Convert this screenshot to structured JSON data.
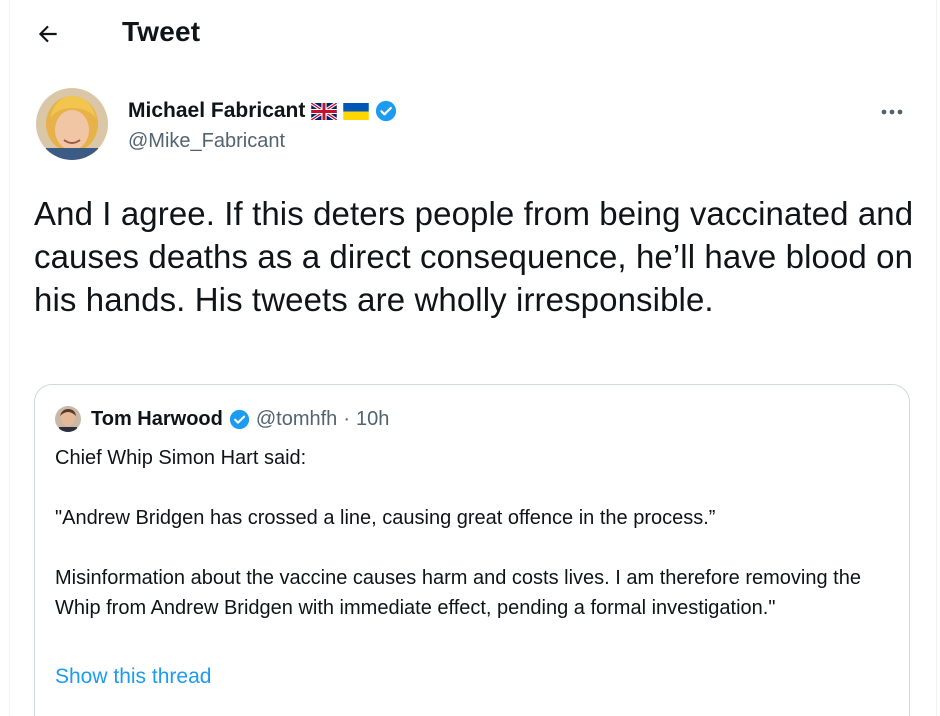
{
  "header": {
    "back_icon": "arrow-left-icon",
    "title": "Tweet"
  },
  "tweet": {
    "author": {
      "display_name": "Michael Fabricant",
      "handle": "@Mike_Fabricant",
      "badges": [
        "uk-flag-icon",
        "ukraine-flag-icon",
        "verified-badge-icon"
      ]
    },
    "more_icon": "more-horizontal-icon",
    "text": "And I agree. If this deters people from being vaccinated and causes deaths as a direct consequence, he’ll have blood on his hands. His tweets are wholly irresponsible."
  },
  "quote": {
    "author": {
      "display_name": "Tom Harwood",
      "handle": "@tomhfh",
      "separator": "·",
      "time": "10h"
    },
    "paragraphs": [
      "Chief Whip Simon Hart said:",
      "\"Andrew Bridgen has crossed a line, causing great offence in the process.”",
      "Misinformation about the vaccine causes harm and costs lives. I am therefore removing the Whip from Andrew Bridgen with immediate effect, pending a formal investigation.\""
    ],
    "show_thread_label": "Show this thread"
  },
  "colors": {
    "link": "#1d9bf0",
    "verified": "#1d9bf0",
    "secondary_text": "#536471",
    "border": "#cfd9de"
  }
}
